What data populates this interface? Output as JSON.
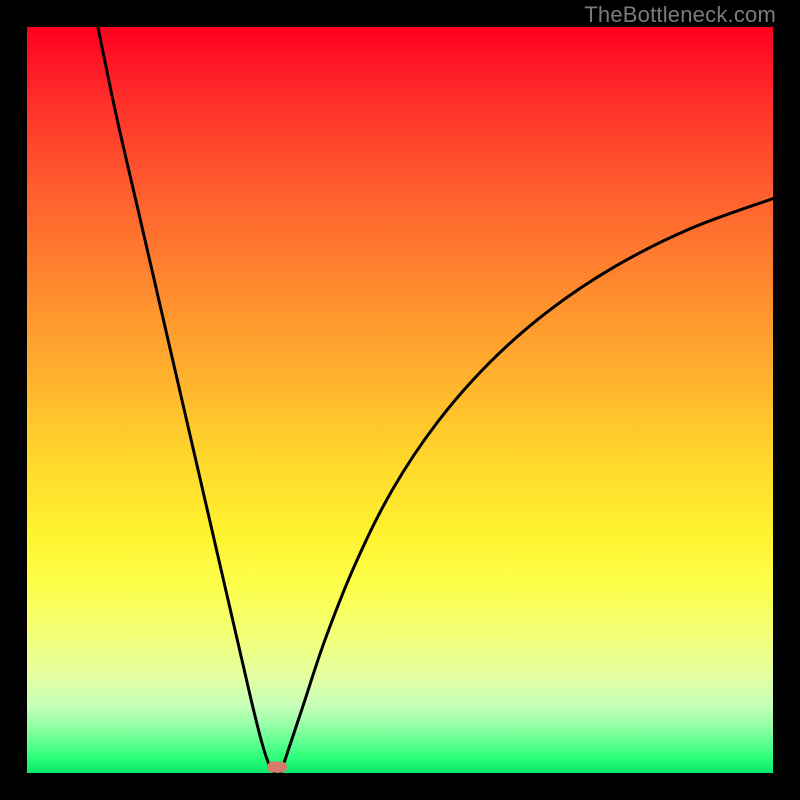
{
  "watermark": "TheBottleneck.com",
  "chart_data": {
    "type": "line",
    "title": "",
    "xlabel": "",
    "ylabel": "",
    "xlim": [
      0,
      100
    ],
    "ylim": [
      0,
      100
    ],
    "series": [
      {
        "name": "left-branch",
        "x": [
          9.5,
          12,
          15,
          18,
          21,
          24,
          27,
          30,
          31.5,
          32.5,
          33.2
        ],
        "values": [
          100,
          88,
          75,
          62,
          49,
          36,
          23,
          10,
          4,
          1,
          0
        ]
      },
      {
        "name": "right-branch",
        "x": [
          34.0,
          35,
          37,
          40,
          44,
          49,
          55,
          62,
          70,
          79,
          89,
          100
        ],
        "values": [
          0,
          3,
          9,
          18,
          28,
          38,
          47,
          55,
          62,
          68,
          73,
          77
        ]
      }
    ],
    "marker": {
      "x": 33.5,
      "y": 0.8
    },
    "gradient_stops": [
      {
        "offset": 0,
        "color": "#ff0020"
      },
      {
        "offset": 35,
        "color": "#ff8a2f"
      },
      {
        "offset": 68,
        "color": "#fff32e"
      },
      {
        "offset": 100,
        "color": "#06e86b"
      }
    ]
  }
}
